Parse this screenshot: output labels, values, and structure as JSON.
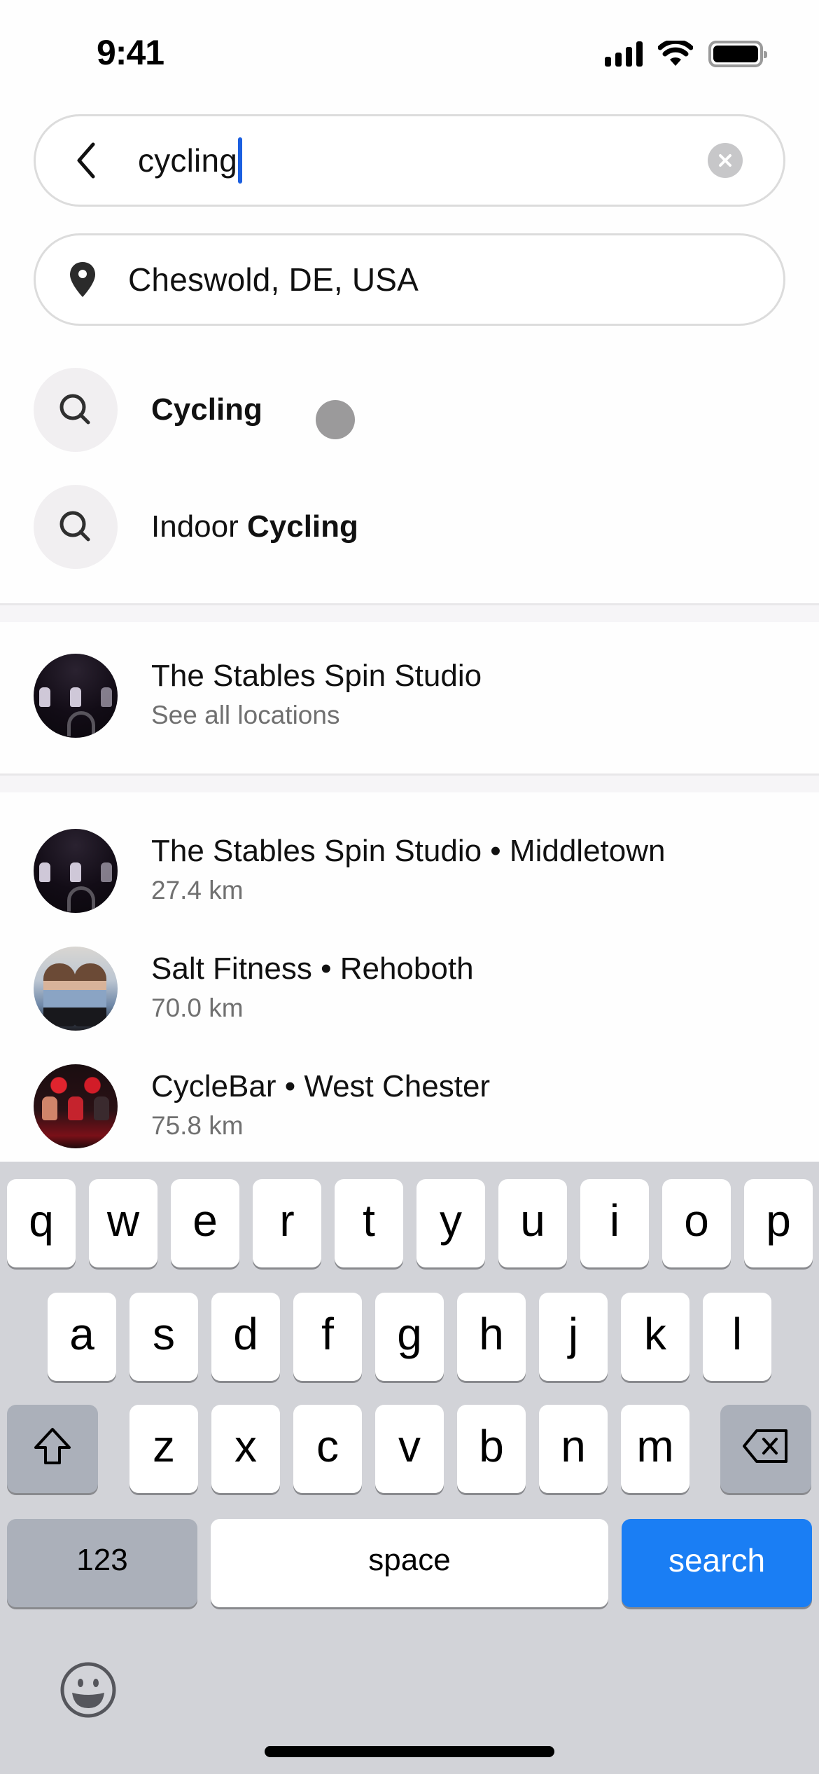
{
  "status_bar": {
    "time": "9:41",
    "icons": [
      "cellular-signal-icon",
      "wifi-icon",
      "battery-icon"
    ]
  },
  "search": {
    "query": "cycling",
    "back_icon": "chevron-left-icon",
    "clear_icon": "clear-x-icon"
  },
  "location": {
    "value": "Cheswold, DE, USA",
    "icon": "map-pin-icon"
  },
  "suggestions": [
    {
      "prefix": "",
      "highlight": "Cycling",
      "icon": "search-icon"
    },
    {
      "prefix": "Indoor ",
      "highlight": "Cycling",
      "icon": "search-icon"
    }
  ],
  "brand_result": {
    "title": "The Stables Spin Studio",
    "subtitle": "See all locations"
  },
  "location_results": [
    {
      "title": "The Stables Spin Studio • Middletown",
      "distance": "27.4 km"
    },
    {
      "title": "Salt Fitness • Rehoboth",
      "distance": "70.0 km"
    },
    {
      "title": "CycleBar • West Chester",
      "distance": "75.8 km"
    }
  ],
  "keyboard": {
    "row1": [
      "q",
      "w",
      "e",
      "r",
      "t",
      "y",
      "u",
      "i",
      "o",
      "p"
    ],
    "row2": [
      "a",
      "s",
      "d",
      "f",
      "g",
      "h",
      "j",
      "k",
      "l"
    ],
    "row3": [
      "z",
      "x",
      "c",
      "v",
      "b",
      "n",
      "m"
    ],
    "numbers_label": "123",
    "space_label": "space",
    "action_label": "search",
    "action_color": "#1a7ef4",
    "shift_icon": "shift-arrow-icon",
    "delete_icon": "backspace-icon",
    "emoji_icon": "emoji-smiley-icon"
  }
}
